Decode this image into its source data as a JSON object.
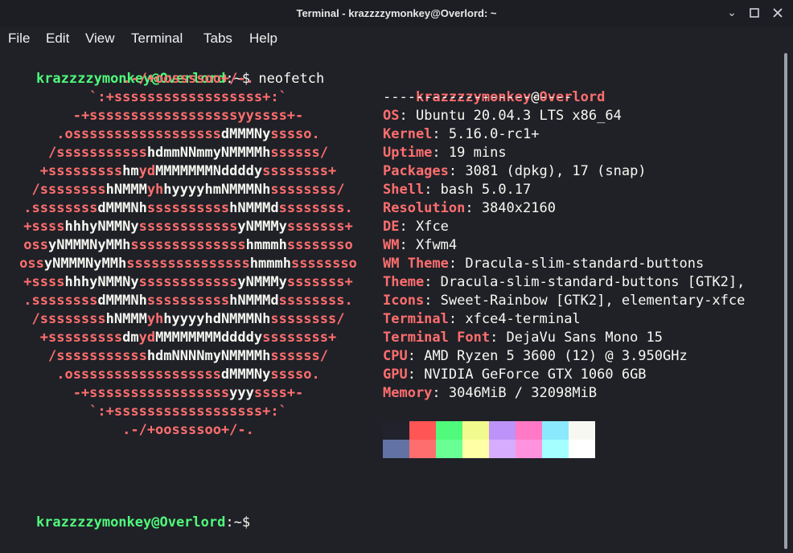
{
  "window": {
    "title": "Terminal - krazzzzymonkey@Overlord: ~",
    "minimize_icon": "chevron-down-icon",
    "maximize_icon": "square-icon",
    "close_icon": "close-icon"
  },
  "menu": [
    "File",
    "Edit",
    "View",
    "Terminal",
    "Tabs",
    "Help"
  ],
  "prompt": {
    "user_host": "krazzzzymonkey@Overlord",
    "path": ":~$",
    "command": "neofetch"
  },
  "logo": [
    [
      {
        "t": ".-/+oossssoo+/-.",
        "c": "r"
      }
    ],
    [
      {
        "t": "`:+ssssssssssssssssss+:`",
        "c": "r"
      }
    ],
    [
      {
        "t": "-+ssssssssssssssssssyyssss+-",
        "c": "r"
      }
    ],
    [
      {
        "t": ".ossssssssssssssssss",
        "c": "r"
      },
      {
        "t": "dMMMNy",
        "c": "w"
      },
      {
        "t": "sssso.",
        "c": "r"
      }
    ],
    [
      {
        "t": "/sssssssssss",
        "c": "r"
      },
      {
        "t": "hdmmNNmmyNMMMMh",
        "c": "w"
      },
      {
        "t": "ssssss/",
        "c": "r"
      }
    ],
    [
      {
        "t": "+sssssssss",
        "c": "r"
      },
      {
        "t": "hm",
        "c": "w"
      },
      {
        "t": "yd",
        "c": "r"
      },
      {
        "t": "MMMMMMMNddddy",
        "c": "w"
      },
      {
        "t": "ssssssss+",
        "c": "r"
      }
    ],
    [
      {
        "t": "/ssssssss",
        "c": "r"
      },
      {
        "t": "hNMMM",
        "c": "w"
      },
      {
        "t": "yh",
        "c": "r"
      },
      {
        "t": "hyyyyhmNMMMNh",
        "c": "w"
      },
      {
        "t": "ssssssss/",
        "c": "r"
      }
    ],
    [
      {
        "t": ".ssssssss",
        "c": "r"
      },
      {
        "t": "dMMMNh",
        "c": "w"
      },
      {
        "t": "ssssssssss",
        "c": "r"
      },
      {
        "t": "hNMMMd",
        "c": "w"
      },
      {
        "t": "ssssssss.",
        "c": "r"
      }
    ],
    [
      {
        "t": "+ssss",
        "c": "r"
      },
      {
        "t": "hhhyNMMNy",
        "c": "w"
      },
      {
        "t": "ssssssssssss",
        "c": "r"
      },
      {
        "t": "yNMMMy",
        "c": "w"
      },
      {
        "t": "sssssss+",
        "c": "r"
      }
    ],
    [
      {
        "t": "oss",
        "c": "r"
      },
      {
        "t": "yNMMMNyMMh",
        "c": "w"
      },
      {
        "t": "ssssssssssssss",
        "c": "r"
      },
      {
        "t": "hmmmh",
        "c": "w"
      },
      {
        "t": "ssssssso",
        "c": "r"
      }
    ],
    [
      {
        "t": "oss",
        "c": "r"
      },
      {
        "t": "yNMMMNyMMh",
        "c": "w"
      },
      {
        "t": "sssssssssssssss",
        "c": "r"
      },
      {
        "t": "hmmmh",
        "c": "w"
      },
      {
        "t": "ssssssso",
        "c": "r"
      }
    ],
    [
      {
        "t": "+ssss",
        "c": "r"
      },
      {
        "t": "hhhyNMMNy",
        "c": "w"
      },
      {
        "t": "ssssssssssss",
        "c": "r"
      },
      {
        "t": "yNMMMy",
        "c": "w"
      },
      {
        "t": "sssssss+",
        "c": "r"
      }
    ],
    [
      {
        "t": ".ssssssss",
        "c": "r"
      },
      {
        "t": "dMMMNh",
        "c": "w"
      },
      {
        "t": "ssssssssss",
        "c": "r"
      },
      {
        "t": "hNMMMd",
        "c": "w"
      },
      {
        "t": "ssssssss.",
        "c": "r"
      }
    ],
    [
      {
        "t": "/ssssssss",
        "c": "r"
      },
      {
        "t": "hNMMM",
        "c": "w"
      },
      {
        "t": "yh",
        "c": "r"
      },
      {
        "t": "hyyyyhdNMMMNh",
        "c": "w"
      },
      {
        "t": "ssssssss/",
        "c": "r"
      }
    ],
    [
      {
        "t": "+sssssssss",
        "c": "r"
      },
      {
        "t": "dm",
        "c": "w"
      },
      {
        "t": "yd",
        "c": "r"
      },
      {
        "t": "MMMMMMMMddddy",
        "c": "w"
      },
      {
        "t": "ssssssss+",
        "c": "r"
      }
    ],
    [
      {
        "t": "/sssssssssss",
        "c": "r"
      },
      {
        "t": "hdmNNNNmyNMMMMh",
        "c": "w"
      },
      {
        "t": "ssssss/",
        "c": "r"
      }
    ],
    [
      {
        "t": ".ossssssssssssssssss",
        "c": "r"
      },
      {
        "t": "dMMMNy",
        "c": "w"
      },
      {
        "t": "sssso.",
        "c": "r"
      }
    ],
    [
      {
        "t": "-+sssssssssssssssss",
        "c": "r"
      },
      {
        "t": "yyy",
        "c": "w"
      },
      {
        "t": "ssss+-",
        "c": "r"
      }
    ],
    [
      {
        "t": "`:+ssssssssssssssssss+:`",
        "c": "r"
      }
    ],
    [
      {
        "t": ".-/+oossssoo+/-.",
        "c": "r"
      }
    ]
  ],
  "info": {
    "user": "krazzzzymonkey",
    "at": "@",
    "host": "Overlord",
    "separator": "-----------------------",
    "fields": [
      {
        "key": "OS",
        "value": "Ubuntu 20.04.3 LTS x86_64"
      },
      {
        "key": "Kernel",
        "value": "5.16.0-rc1+"
      },
      {
        "key": "Uptime",
        "value": "19 mins"
      },
      {
        "key": "Packages",
        "value": "3081 (dpkg), 17 (snap)"
      },
      {
        "key": "Shell",
        "value": "bash 5.0.17"
      },
      {
        "key": "Resolution",
        "value": "3840x2160"
      },
      {
        "key": "DE",
        "value": "Xfce"
      },
      {
        "key": "WM",
        "value": "Xfwm4"
      },
      {
        "key": "WM Theme",
        "value": "Dracula-slim-standard-buttons"
      },
      {
        "key": "Theme",
        "value": "Dracula-slim-standard-buttons [GTK2],"
      },
      {
        "key": "Icons",
        "value": "Sweet-Rainbow [GTK2], elementary-xfce"
      },
      {
        "key": "Terminal",
        "value": "xfce4-terminal"
      },
      {
        "key": "Terminal Font",
        "value": "DejaVu Sans Mono 15"
      },
      {
        "key": "CPU",
        "value": "AMD Ryzen 5 3600 (12) @ 3.950GHz"
      },
      {
        "key": "GPU",
        "value": "NVIDIA GeForce GTX 1060 6GB"
      },
      {
        "key": "Memory",
        "value": "3046MiB / 32098MiB"
      }
    ],
    "palette_dark": [
      "#21222c",
      "#ff5555",
      "#50fa7b",
      "#f1fa8c",
      "#bd93f9",
      "#ff79c6",
      "#8be9fd",
      "#f8f8f2"
    ],
    "palette_bright": [
      "#6272a4",
      "#ff6e6e",
      "#69ff94",
      "#ffffa5",
      "#d6acff",
      "#ff92df",
      "#a4ffff",
      "#ffffff"
    ]
  },
  "prompt2": {
    "user_host": "krazzzzymonkey@Overlord",
    "path": ":~$"
  }
}
